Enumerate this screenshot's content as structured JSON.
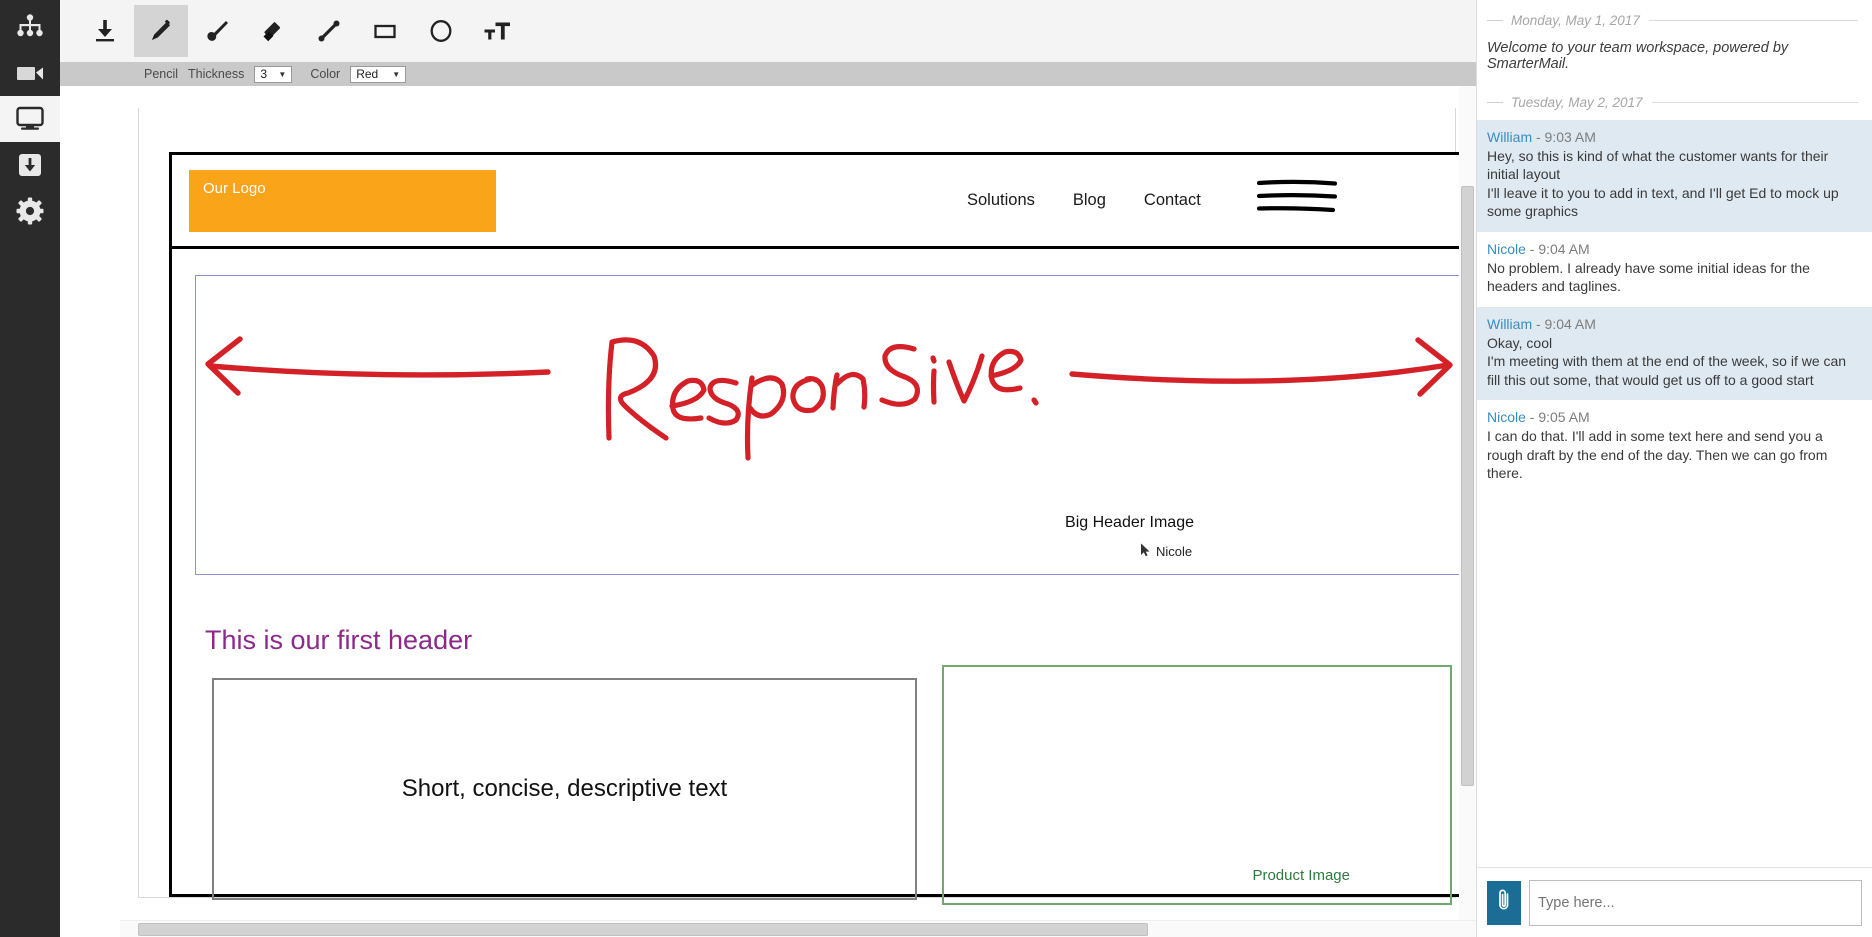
{
  "rail": {
    "items": [
      {
        "name": "sitemap-icon",
        "label": "Organization"
      },
      {
        "name": "video-camera-icon",
        "label": "Video"
      },
      {
        "name": "monitor-icon",
        "label": "Screen Share",
        "active": true
      },
      {
        "name": "download-box-icon",
        "label": "Downloads"
      },
      {
        "name": "gear-icon",
        "label": "Settings"
      }
    ]
  },
  "toolbar": {
    "tools": [
      {
        "name": "download-tool",
        "label": "Download"
      },
      {
        "name": "pencil-tool",
        "label": "Pencil",
        "active": true
      },
      {
        "name": "brush-tool",
        "label": "Brush"
      },
      {
        "name": "eraser-tool",
        "label": "Eraser"
      },
      {
        "name": "line-tool",
        "label": "Line"
      },
      {
        "name": "rectangle-tool",
        "label": "Rectangle"
      },
      {
        "name": "ellipse-tool",
        "label": "Ellipse"
      },
      {
        "name": "text-tool",
        "label": "Text"
      }
    ]
  },
  "options": {
    "tool_name": "Pencil",
    "thickness_label": "Thickness",
    "thickness_value": "3",
    "color_label": "Color",
    "color_value": "Red",
    "caret": "▼"
  },
  "mockup": {
    "logo_text": "Our Logo",
    "logo_color": "#FAA41A",
    "nav": [
      "Solutions",
      "Blog",
      "Contact"
    ],
    "hero_label": "Big Header Image",
    "annotation_text": "Responsive",
    "annotation_color": "#D42027",
    "cursor_user": "Nicole",
    "section_header": "This is our first header",
    "section_header_color": "#8B2A8B",
    "body_text": "Short, concise, descriptive text",
    "product_label": "Product Image",
    "product_border_color": "#70A870"
  },
  "chat": {
    "days": [
      {
        "date": "Monday, May 1, 2017",
        "system": "Welcome to your team workspace, powered by SmarterMail."
      },
      {
        "date": "Tuesday, May 2, 2017"
      }
    ],
    "messages": [
      {
        "author": "William",
        "time": " - 9:03 AM",
        "lines": [
          "Hey, so this is kind of what the customer wants for their initial layout",
          "I'll leave it to you to add in text, and I'll get Ed to mock up some graphics"
        ],
        "highlight": true
      },
      {
        "author": "Nicole",
        "time": " - 9:04 AM",
        "lines": [
          "No problem. I already have some initial ideas for the headers and taglines."
        ],
        "highlight": false
      },
      {
        "author": "William",
        "time": " - 9:04 AM",
        "lines": [
          "Okay, cool",
          "I'm meeting with them at the end of the week, so if we can fill this out some, that would get us off to a good start"
        ],
        "highlight": true
      },
      {
        "author": "Nicole",
        "time": " - 9:05 AM",
        "lines": [
          "I can do that. I'll add in some text here and send you a rough draft by the end of the day. Then we can go from there."
        ],
        "highlight": false
      }
    ],
    "compose": {
      "placeholder": "Type here...",
      "attach_icon": "paperclip-icon"
    }
  }
}
